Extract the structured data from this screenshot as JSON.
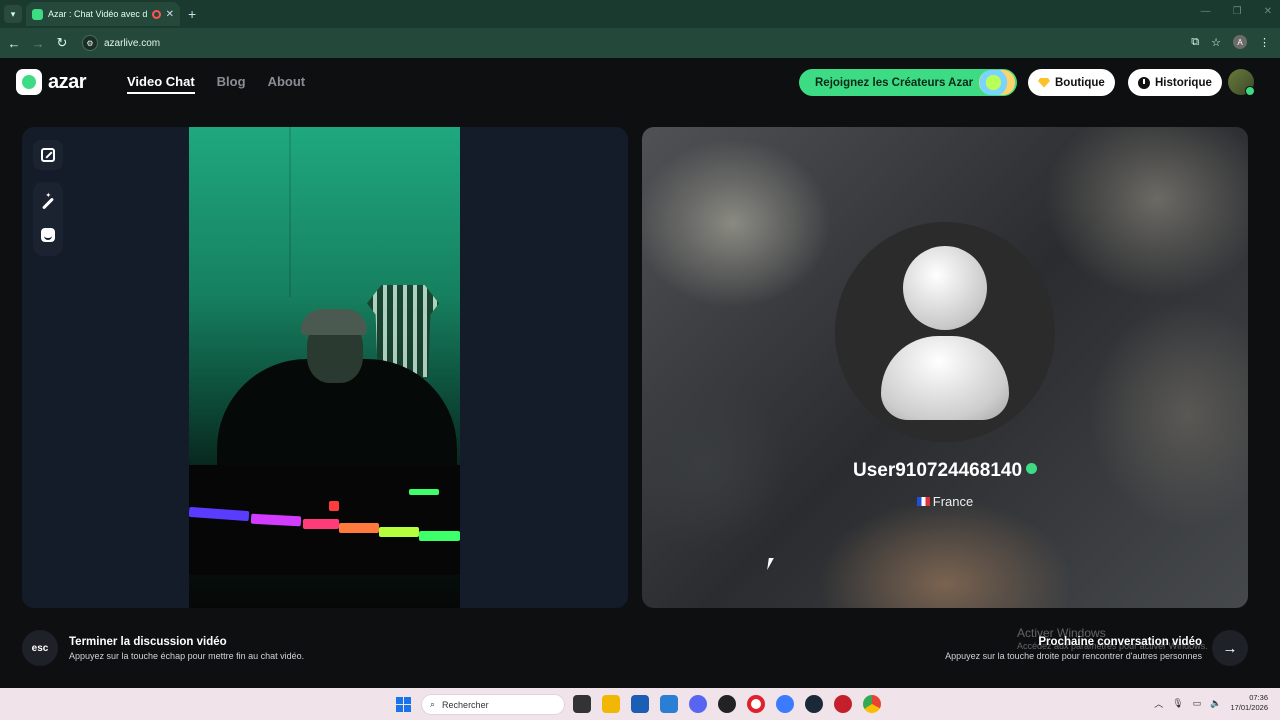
{
  "browser": {
    "tab_title": "Azar : Chat Vidéo avec de n",
    "url": "azarlive.com",
    "account_initial": "A"
  },
  "header": {
    "logo_text": "azar",
    "nav": [
      {
        "label": "Video Chat",
        "active": true
      },
      {
        "label": "Blog",
        "active": false
      },
      {
        "label": "About",
        "active": false
      }
    ],
    "creators_label": "Rejoignez les Créateurs Azar",
    "shop_label": "Boutique",
    "history_label": "Historique"
  },
  "partner": {
    "username": "User910724468140",
    "country": "France"
  },
  "bottom": {
    "esc_key": "esc",
    "end_title": "Terminer la discussion vidéo",
    "end_sub": "Appuyez sur la touche échap pour mettre fin au chat vidéo.",
    "next_title": "Prochaine conversation vidéo",
    "next_sub": "Appuyez sur la touche droite pour rencontrer d'autres personnes"
  },
  "watermark": {
    "title": "Activer Windows",
    "sub": "Accédez aux paramètres pour activer Windows."
  },
  "taskbar": {
    "search_placeholder": "Rechercher",
    "time": "07:36",
    "date": "17/01/2026"
  },
  "colors": {
    "accent": "#3ddc84",
    "browser_chrome": "#24493b",
    "taskbar": "#f1e3ea"
  }
}
